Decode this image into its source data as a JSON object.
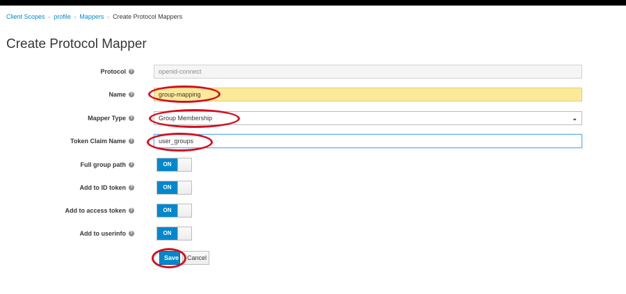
{
  "breadcrumb": {
    "items": [
      "Client Scopes",
      "profile",
      "Mappers"
    ],
    "current": "Create Protocol Mappers",
    "separator": "›"
  },
  "page": {
    "title": "Create Protocol Mapper"
  },
  "form": {
    "protocol": {
      "label": "Protocol",
      "value": "openid-connect"
    },
    "name": {
      "label": "Name",
      "value": "group-mapping"
    },
    "mapper_type": {
      "label": "Mapper Type",
      "value": "Group Membership"
    },
    "token_claim_name": {
      "label": "Token Claim Name",
      "value": "user_groups"
    },
    "full_group_path": {
      "label": "Full group path",
      "state": "ON"
    },
    "add_to_id_token": {
      "label": "Add to ID token",
      "state": "ON"
    },
    "add_to_access_token": {
      "label": "Add to access token",
      "state": "ON"
    },
    "add_to_userinfo": {
      "label": "Add to userinfo",
      "state": "ON"
    }
  },
  "actions": {
    "save": "Save",
    "cancel": "Cancel"
  },
  "icons": {
    "help": "question-circle-icon",
    "select": "chevron-down-icon"
  },
  "colors": {
    "accent": "#0088ce",
    "highlight": "#fde99a",
    "annotation": "#d40f1f"
  }
}
